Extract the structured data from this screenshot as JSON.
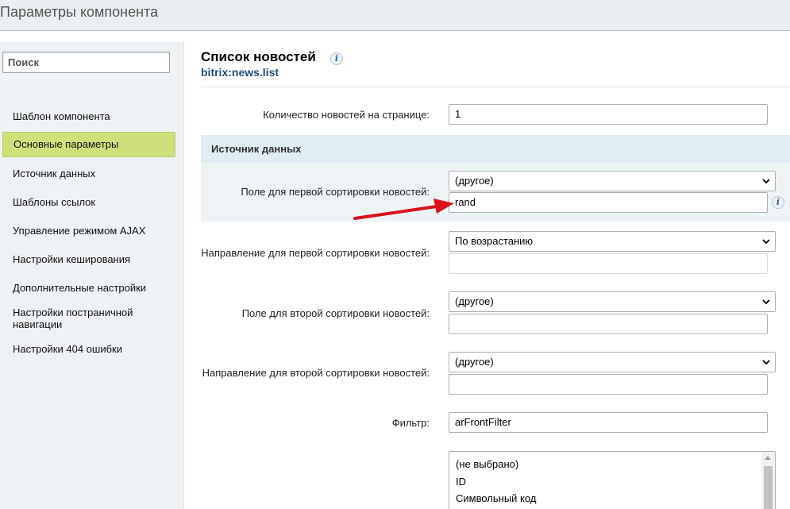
{
  "window": {
    "title": "Параметры компонента"
  },
  "sidebar": {
    "search_placeholder": "Поиск",
    "items": [
      {
        "label": "Шаблон компонента"
      },
      {
        "label": "Основные параметры"
      },
      {
        "label": "Источник данных"
      },
      {
        "label": "Шаблоны ссылок"
      },
      {
        "label": "Управление режимом AJAX"
      },
      {
        "label": "Настройки кеширования"
      },
      {
        "label": "Дополнительные настройки"
      },
      {
        "label": "Настройки постраничной навигации"
      },
      {
        "label": "Настройки 404 ошибки"
      }
    ],
    "active_item": "Основные параметры"
  },
  "component": {
    "title": "Список новостей",
    "code": "bitrix:news.list",
    "info_glyph": "i"
  },
  "params": {
    "news_count": {
      "label": "Количество новостей на странице:",
      "value": "1"
    },
    "section": "Источник данных",
    "sort_field_1": {
      "label": "Поле для первой сортировки новостей:",
      "selected": "(другое)",
      "custom_value": "rand"
    },
    "sort_order_1": {
      "label": "Направление для первой сортировки новостей:",
      "selected": "По возрастанию",
      "custom_value": ""
    },
    "sort_field_2": {
      "label": "Поле для второй сортировки новостей:",
      "selected": "(другое)",
      "custom_value": ""
    },
    "sort_order_2": {
      "label": "Направление для второй сортировки новостей:",
      "selected": "(другое)",
      "custom_value": ""
    },
    "filter": {
      "label": "Фильтр:",
      "value": "arFrontFilter"
    },
    "field_list": [
      "(не выбрано)",
      "ID",
      "Символьный код"
    ]
  },
  "colors": {
    "active_nav": "#cde07a",
    "section_header": "#e1ebf2",
    "link_code": "#1f4f7a",
    "annotation_arrow": "#d9121b"
  },
  "icons": [
    "info-icon",
    "chevron-down-icon",
    "arrow-annotation",
    "scroll-up-icon"
  ]
}
